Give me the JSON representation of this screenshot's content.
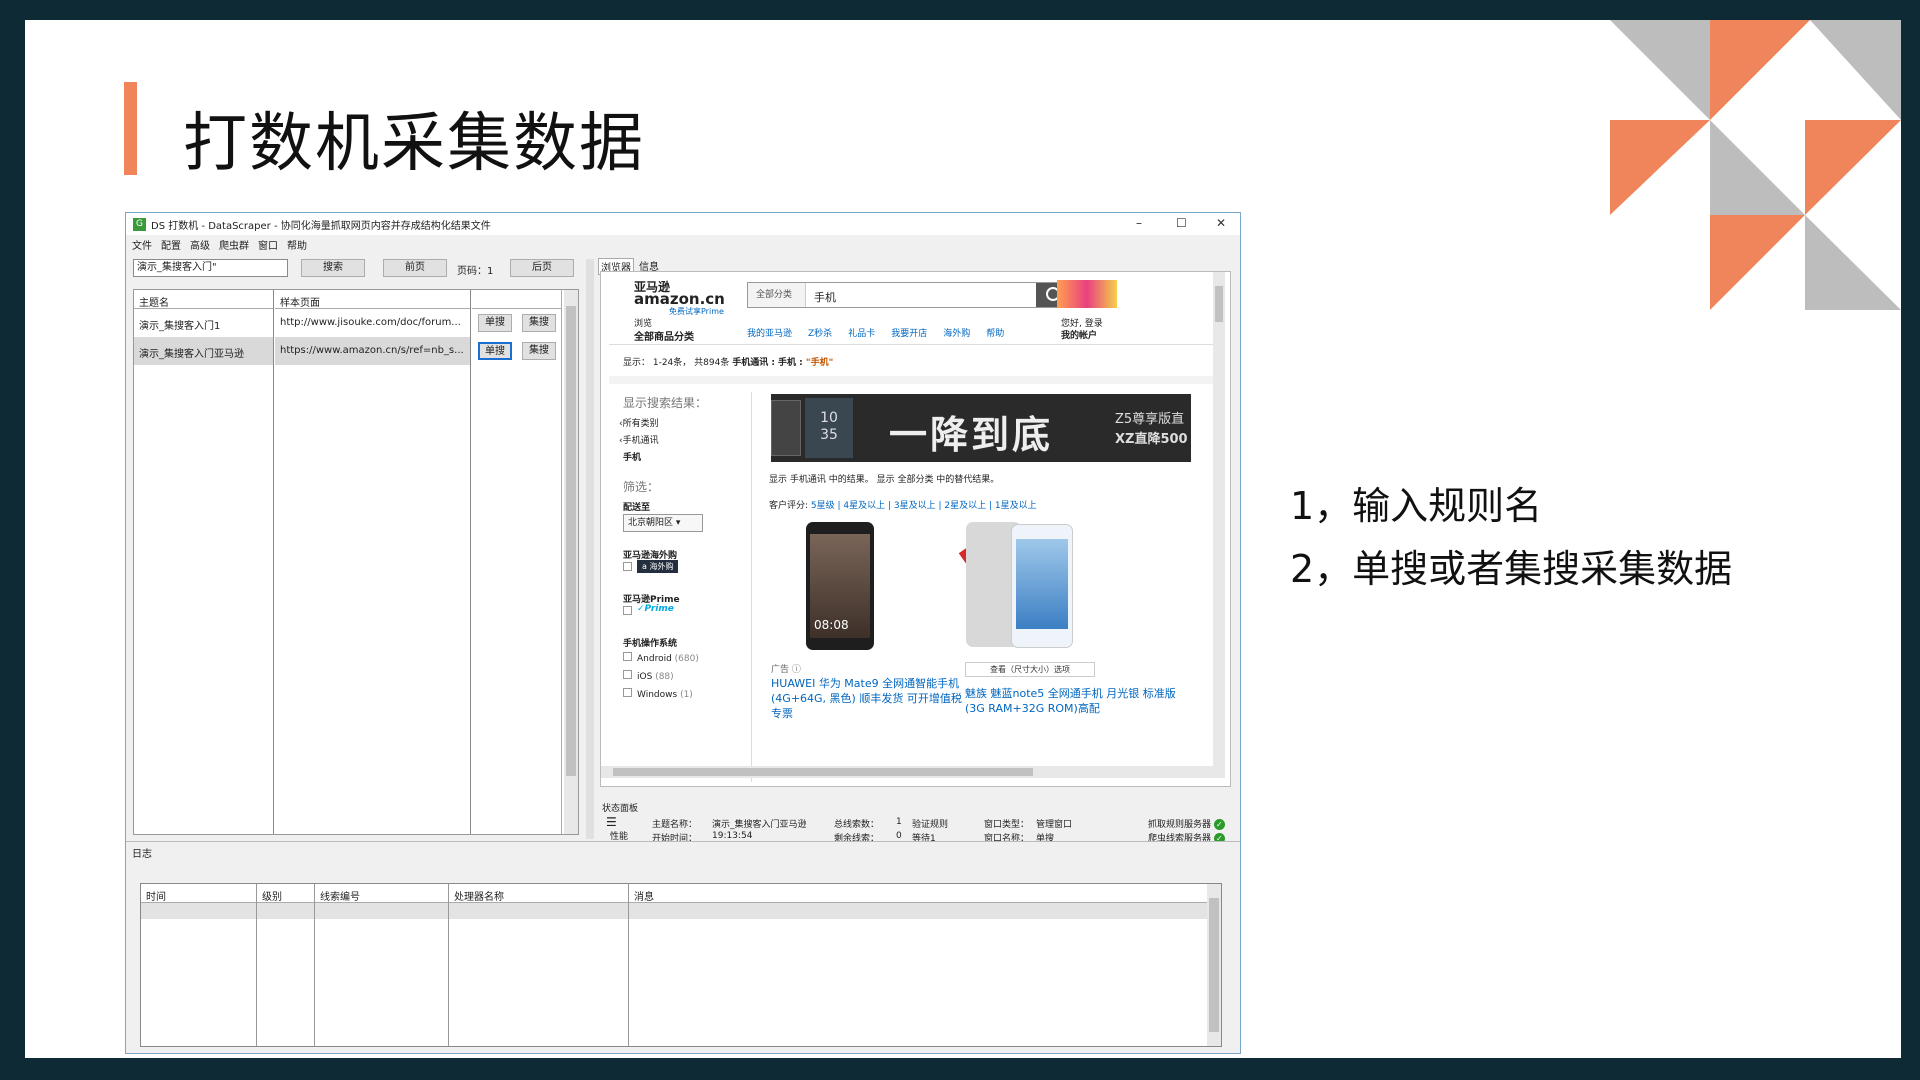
{
  "slide": {
    "title": "打数机采集数据",
    "notes": [
      "1，输入规则名",
      "2，单搜或者集搜采集数据"
    ]
  },
  "colors": {
    "accent": "#f0845a",
    "frame": "#0e2a35",
    "tri_gray": "#bdbdbd"
  },
  "window": {
    "icon": "G",
    "title": "DS 打数机 - DataScraper - 协同化海量抓取网页内容并存成结构化结果文件",
    "controls": [
      "–",
      "☐",
      "✕"
    ],
    "menu": [
      "文件",
      "配置",
      "高级",
      "爬虫群",
      "窗口",
      "帮助"
    ],
    "rule_input": "演示_集搜客入门\"",
    "search_btn": "搜索",
    "prev_btn": "前页",
    "page_label": "页码：1",
    "next_btn": "后页",
    "grid": {
      "col1_header": "主题名",
      "col2_header": "样本页面",
      "rows": [
        {
          "name": "演示_集搜客入门1",
          "url": "http://www.jisouke.com/doc/forum...",
          "single": "单搜",
          "multi": "集搜"
        },
        {
          "name": "演示_集搜客入门亚马逊",
          "url": "https://www.amazon.cn/s/ref=nb_s...",
          "single": "单搜",
          "multi": "集搜"
        }
      ]
    },
    "tabs": [
      "浏览器",
      "信息"
    ],
    "amazon": {
      "logo_cn": "亚马逊",
      "logo": "amazon.cn",
      "prime_trial": "免费试享Prime",
      "category_select": "全部分类",
      "search_value": "手机",
      "browse": "浏览",
      "all_cat": "全部商品分类",
      "nav": [
        "我的亚马逊",
        "Z秒杀",
        "礼品卡",
        "我要开店",
        "海外购",
        "帮助"
      ],
      "hello": "您好, 登录",
      "account": "我的帐户",
      "result_info_a": "显示： 1-24条， 共894条 ",
      "result_info_b": "手机通讯 : 手机 : ",
      "result_info_c": "\"手机\"",
      "sidebar_title": "显示搜索结果：",
      "cats": [
        "‹所有类别",
        "‹手机通讯",
        "手机"
      ],
      "filter_title": "筛选：",
      "deliver_to": "配送至",
      "city": "北京朝阳区 ▾",
      "overseas": "亚马逊海外购",
      "overseas_badge": "a 海外购",
      "prime": "亚马逊Prime",
      "prime_badge": "✓Prime",
      "os_title": "手机操作系统",
      "os": [
        {
          "name": "Android",
          "count": "(680)"
        },
        {
          "name": "iOS",
          "count": "(88)"
        },
        {
          "name": "Windows",
          "count": "(1)"
        }
      ],
      "banner_text": "一降到底",
      "banner_sub1": "Z5尊享版直",
      "banner_sub2": "XZ直降500",
      "banner_date1": "10",
      "banner_date2": "35",
      "result_line": "显示 手机通讯 中的结果。 显示 全部分类 中的替代结果。",
      "rating_label": "客户评分:",
      "ratings": "5星级 | 4星及以上 | 3星及以上 | 2星及以上 | 1星及以上",
      "phone1_time": "08:08",
      "ad_label": "广告 ⓘ",
      "p1_title": "HUAWEI 华为 Mate9 全网通智能手机 (4G+64G, 黑色) 顺丰发货 可开增值税专票",
      "p2_badge": "人气",
      "p2_view": "查看（尺寸大小）选项",
      "p2_title": "魅族 魅蓝note5 全网通手机 月光银 标准版(3G RAM+32G ROM)高配"
    },
    "status": {
      "title": "状态面板",
      "perf": "性能",
      "theme_label": "主题名称：",
      "theme_value": "演示_集搜客入门亚马逊",
      "start_label": "开始时间：",
      "start_value": "19:13:54",
      "total_label": "总线索数：",
      "total_value": "1",
      "verify": "验证规则",
      "remain_label": "剩余线索：",
      "remain_value": "0",
      "wait": "等待1",
      "wtype_label": "窗口类型：",
      "wtype_value": "管理窗口",
      "wname_label": "窗口名称：",
      "wname_value": "单搜",
      "server1": "抓取规则服务器",
      "server2": "爬虫线索服务器",
      "check": "✓"
    },
    "log": {
      "title": "日志",
      "cols": [
        "时间",
        "级别",
        "线索编号",
        "处理器名称",
        "消息"
      ]
    }
  }
}
